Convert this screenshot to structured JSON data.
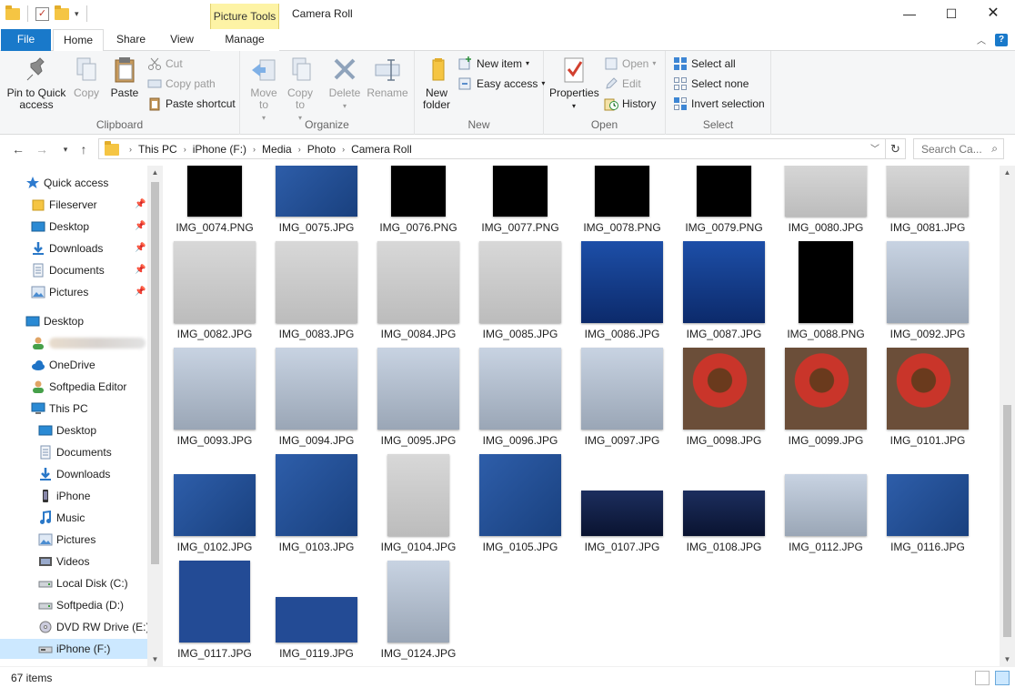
{
  "window": {
    "title": "Camera Roll",
    "context_tab_header": "Picture Tools",
    "minimize": "—",
    "maximize": "☐",
    "close": "✕"
  },
  "ribbon_tabs": [
    "File",
    "Home",
    "Share",
    "View",
    "Manage"
  ],
  "ribbon": {
    "clipboard": {
      "label": "Clipboard",
      "pin": "Pin to Quick access",
      "copy": "Copy",
      "paste": "Paste",
      "cut": "Cut",
      "copy_path": "Copy path",
      "paste_shortcut": "Paste shortcut"
    },
    "organize": {
      "label": "Organize",
      "move_to": "Move to",
      "copy_to": "Copy to",
      "delete": "Delete",
      "rename": "Rename"
    },
    "new": {
      "label": "New",
      "new_folder": "New folder",
      "new_item": "New item",
      "easy_access": "Easy access"
    },
    "open": {
      "label": "Open",
      "properties": "Properties",
      "open": "Open",
      "edit": "Edit",
      "history": "History"
    },
    "select": {
      "label": "Select",
      "select_all": "Select all",
      "select_none": "Select none",
      "invert": "Invert selection"
    }
  },
  "address": {
    "crumbs": [
      "This PC",
      "iPhone (F:)",
      "Media",
      "Photo",
      "Camera Roll"
    ],
    "search_placeholder": "Search Ca..."
  },
  "sidebar": {
    "items": [
      {
        "label": "Quick access",
        "icon": "star-icon",
        "indent": 1,
        "pinned": false
      },
      {
        "label": "Fileserver",
        "icon": "folder-icon",
        "indent": 2,
        "pinned": true
      },
      {
        "label": "Desktop",
        "icon": "desktop-icon",
        "indent": 2,
        "pinned": true
      },
      {
        "label": "Downloads",
        "icon": "download-icon",
        "indent": 2,
        "pinned": true
      },
      {
        "label": "Documents",
        "icon": "document-icon",
        "indent": 2,
        "pinned": true
      },
      {
        "label": "Pictures",
        "icon": "pictures-icon",
        "indent": 2,
        "pinned": true
      },
      {
        "label": "Desktop",
        "icon": "desktop-icon",
        "indent": 1,
        "pinned": false
      },
      {
        "label": "",
        "icon": "user-icon",
        "indent": 2,
        "pinned": false,
        "blurred": true
      },
      {
        "label": "OneDrive",
        "icon": "onedrive-icon",
        "indent": 2,
        "pinned": false
      },
      {
        "label": "Softpedia Editor",
        "icon": "user-icon",
        "indent": 2,
        "pinned": false
      },
      {
        "label": "This PC",
        "icon": "pc-icon",
        "indent": 2,
        "pinned": false
      },
      {
        "label": "Desktop",
        "icon": "desktop-icon",
        "indent": 3,
        "pinned": false
      },
      {
        "label": "Documents",
        "icon": "document-icon",
        "indent": 3,
        "pinned": false
      },
      {
        "label": "Downloads",
        "icon": "download-icon",
        "indent": 3,
        "pinned": false
      },
      {
        "label": "iPhone",
        "icon": "phone-icon",
        "indent": 3,
        "pinned": false
      },
      {
        "label": "Music",
        "icon": "music-icon",
        "indent": 3,
        "pinned": false
      },
      {
        "label": "Pictures",
        "icon": "pictures-icon",
        "indent": 3,
        "pinned": false
      },
      {
        "label": "Videos",
        "icon": "video-icon",
        "indent": 3,
        "pinned": false
      },
      {
        "label": "Local Disk (C:)",
        "icon": "disk-icon",
        "indent": 3,
        "pinned": false
      },
      {
        "label": "Softpedia (D:)",
        "icon": "disk-icon",
        "indent": 3,
        "pinned": false
      },
      {
        "label": "DVD RW Drive (E:)",
        "icon": "dvd-icon",
        "indent": 3,
        "pinned": false
      },
      {
        "label": "iPhone (F:)",
        "icon": "drive-icon",
        "indent": 3,
        "pinned": false,
        "selected": true
      }
    ]
  },
  "files": [
    {
      "name": "IMG_0074.PNG",
      "style": "black",
      "w": 60,
      "h": 60
    },
    {
      "name": "IMG_0075.JPG",
      "style": "pad",
      "w": 90,
      "h": 60
    },
    {
      "name": "IMG_0076.PNG",
      "style": "black",
      "w": 60,
      "h": 60
    },
    {
      "name": "IMG_0077.PNG",
      "style": "black",
      "w": 60,
      "h": 60
    },
    {
      "name": "IMG_0078.PNG",
      "style": "black",
      "w": 60,
      "h": 60
    },
    {
      "name": "IMG_0079.PNG",
      "style": "black",
      "w": 60,
      "h": 60
    },
    {
      "name": "IMG_0080.JPG",
      "style": "photo-gray",
      "w": 90,
      "h": 60
    },
    {
      "name": "IMG_0081.JPG",
      "style": "photo-gray",
      "w": 90,
      "h": 60
    },
    {
      "name": "IMG_0082.JPG",
      "style": "photo-gray",
      "w": 90,
      "h": 90
    },
    {
      "name": "IMG_0083.JPG",
      "style": "photo-gray",
      "w": 90,
      "h": 90
    },
    {
      "name": "IMG_0084.JPG",
      "style": "photo-gray",
      "w": 90,
      "h": 90
    },
    {
      "name": "IMG_0085.JPG",
      "style": "photo-gray",
      "w": 90,
      "h": 90
    },
    {
      "name": "IMG_0086.JPG",
      "style": "screen-blue",
      "w": 90,
      "h": 90
    },
    {
      "name": "IMG_0087.JPG",
      "style": "screen-blue",
      "w": 90,
      "h": 90
    },
    {
      "name": "IMG_0088.PNG",
      "style": "black",
      "w": 60,
      "h": 90
    },
    {
      "name": "IMG_0092.JPG",
      "style": "mac",
      "w": 90,
      "h": 90
    },
    {
      "name": "IMG_0093.JPG",
      "style": "mac",
      "w": 90,
      "h": 90
    },
    {
      "name": "IMG_0094.JPG",
      "style": "mac",
      "w": 90,
      "h": 90
    },
    {
      "name": "IMG_0095.JPG",
      "style": "mac",
      "w": 90,
      "h": 90
    },
    {
      "name": "IMG_0096.JPG",
      "style": "mac",
      "w": 90,
      "h": 90
    },
    {
      "name": "IMG_0097.JPG",
      "style": "mac",
      "w": 90,
      "h": 90
    },
    {
      "name": "IMG_0098.JPG",
      "style": "cup",
      "w": 90,
      "h": 90
    },
    {
      "name": "IMG_0099.JPG",
      "style": "cup",
      "w": 90,
      "h": 90
    },
    {
      "name": "IMG_0101.JPG",
      "style": "cup",
      "w": 90,
      "h": 90
    },
    {
      "name": "IMG_0102.JPG",
      "style": "pad",
      "w": 90,
      "h": 68
    },
    {
      "name": "IMG_0103.JPG",
      "style": "pad",
      "w": 90,
      "h": 90
    },
    {
      "name": "IMG_0104.JPG",
      "style": "photo-gray",
      "w": 68,
      "h": 90
    },
    {
      "name": "IMG_0105.JPG",
      "style": "pad",
      "w": 90,
      "h": 90
    },
    {
      "name": "IMG_0107.JPG",
      "style": "darkblue",
      "w": 90,
      "h": 50
    },
    {
      "name": "IMG_0108.JPG",
      "style": "darkblue",
      "w": 90,
      "h": 50
    },
    {
      "name": "IMG_0112.JPG",
      "style": "mac",
      "w": 90,
      "h": 68
    },
    {
      "name": "IMG_0116.JPG",
      "style": "pad",
      "w": 90,
      "h": 68
    },
    {
      "name": "IMG_0117.JPG",
      "style": "sblue",
      "w": 78,
      "h": 90
    },
    {
      "name": "IMG_0119.JPG",
      "style": "sblue",
      "w": 90,
      "h": 50
    },
    {
      "name": "IMG_0124.JPG",
      "style": "mac",
      "w": 68,
      "h": 90
    }
  ],
  "status": {
    "count": "67 items"
  }
}
